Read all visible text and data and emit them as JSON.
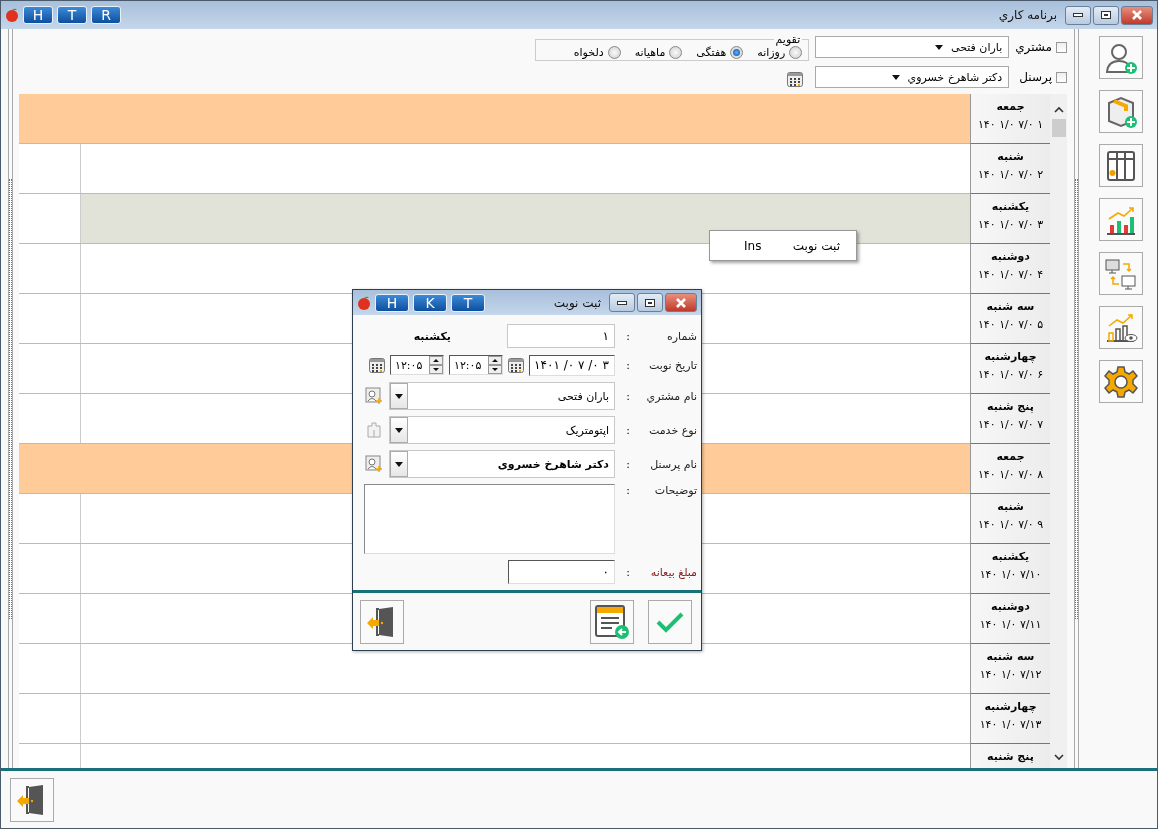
{
  "window": {
    "title": "برنامه کاري",
    "title_buttons": [
      "R",
      "T",
      "H"
    ]
  },
  "filters": {
    "customer": {
      "label": "مشتري",
      "checked": false,
      "value": "باران فتحی"
    },
    "staff": {
      "label": "پرسنل",
      "checked": false,
      "value": "دکتر شاهرخ خسروي"
    },
    "view": {
      "title": "تقويم",
      "options": [
        {
          "label": "روزانه",
          "selected": false
        },
        {
          "label": "هفتگی",
          "selected": true
        },
        {
          "label": "ماهیانه",
          "selected": false
        },
        {
          "label": "دلخواه",
          "selected": false
        }
      ]
    }
  },
  "calendar": {
    "rows": [
      {
        "day": "جمعه",
        "date": "۱۴۰ ۱/۰ ۷/۰ ۱",
        "holiday": true,
        "selected": false
      },
      {
        "day": "شنبه",
        "date": "۱۴۰ ۱/۰ ۷/۰ ۲",
        "holiday": false,
        "selected": false
      },
      {
        "day": "یکشنبه",
        "date": "۱۴۰ ۱/۰ ۷/۰ ۳",
        "holiday": false,
        "selected": true
      },
      {
        "day": "دوشنبه",
        "date": "۱۴۰ ۱/۰ ۷/۰ ۴",
        "holiday": false,
        "selected": false
      },
      {
        "day": "سه شنبه",
        "date": "۱۴۰ ۱/۰ ۷/۰ ۵",
        "holiday": false,
        "selected": false
      },
      {
        "day": "چهارشنبه",
        "date": "۱۴۰ ۱/۰ ۷/۰ ۶",
        "holiday": false,
        "selected": false
      },
      {
        "day": "پنج شنبه",
        "date": "۱۴۰ ۱/۰ ۷/۰ ۷",
        "holiday": false,
        "selected": false
      },
      {
        "day": "جمعه",
        "date": "۱۴۰ ۱/۰ ۷/۰ ۸",
        "holiday": true,
        "selected": false
      },
      {
        "day": "شنبه",
        "date": "۱۴۰ ۱/۰ ۷/۰ ۹",
        "holiday": false,
        "selected": false
      },
      {
        "day": "یکشنبه",
        "date": "۱۴۰ ۱/۰ ۷/۱۰",
        "holiday": false,
        "selected": false
      },
      {
        "day": "دوشنبه",
        "date": "۱۴۰ ۱/۰ ۷/۱۱",
        "holiday": false,
        "selected": false
      },
      {
        "day": "سه شنبه",
        "date": "۱۴۰ ۱/۰ ۷/۱۲",
        "holiday": false,
        "selected": false
      },
      {
        "day": "چهارشنبه",
        "date": "۱۴۰ ۱/۰ ۷/۱۳",
        "holiday": false,
        "selected": false
      },
      {
        "day": "پنج شنبه",
        "holiday": false,
        "selected": false
      }
    ]
  },
  "context_menu": {
    "items": [
      {
        "label": "ثبت نوبت",
        "shortcut": "Ins"
      }
    ]
  },
  "dialog": {
    "title": "ثبت نوبت",
    "title_buttons": [
      "T",
      "K",
      "H"
    ],
    "fields": [
      {
        "kind": "number",
        "label": "شماره",
        "colon": ":",
        "value": "۱",
        "weekday": "یکشنبه"
      },
      {
        "kind": "datetime",
        "label": "تاریخ نوبت",
        "colon": ":",
        "value": "۱۴۰۱ /۰ ۷ /۰ ۳",
        "time_from": "۱۲:۰۵",
        "time_to": "۱۲:۰۵"
      },
      {
        "kind": "combo",
        "label": "نام مشتري",
        "colon": ":",
        "value": "باران فتحی",
        "bold": false
      },
      {
        "kind": "combo",
        "label": "نوع خدمت",
        "colon": ":",
        "value": "اپتومتریک",
        "bold": false
      },
      {
        "kind": "combo",
        "label": "نام پرسنل",
        "colon": ":",
        "value": "دکتر شاهرخ خسروی",
        "bold": true
      },
      {
        "kind": "notes",
        "label": "توضیحات",
        "colon": ":"
      },
      {
        "kind": "amount",
        "label": "مبلغ بیعانه",
        "colon": ":",
        "value": "۰"
      }
    ]
  }
}
